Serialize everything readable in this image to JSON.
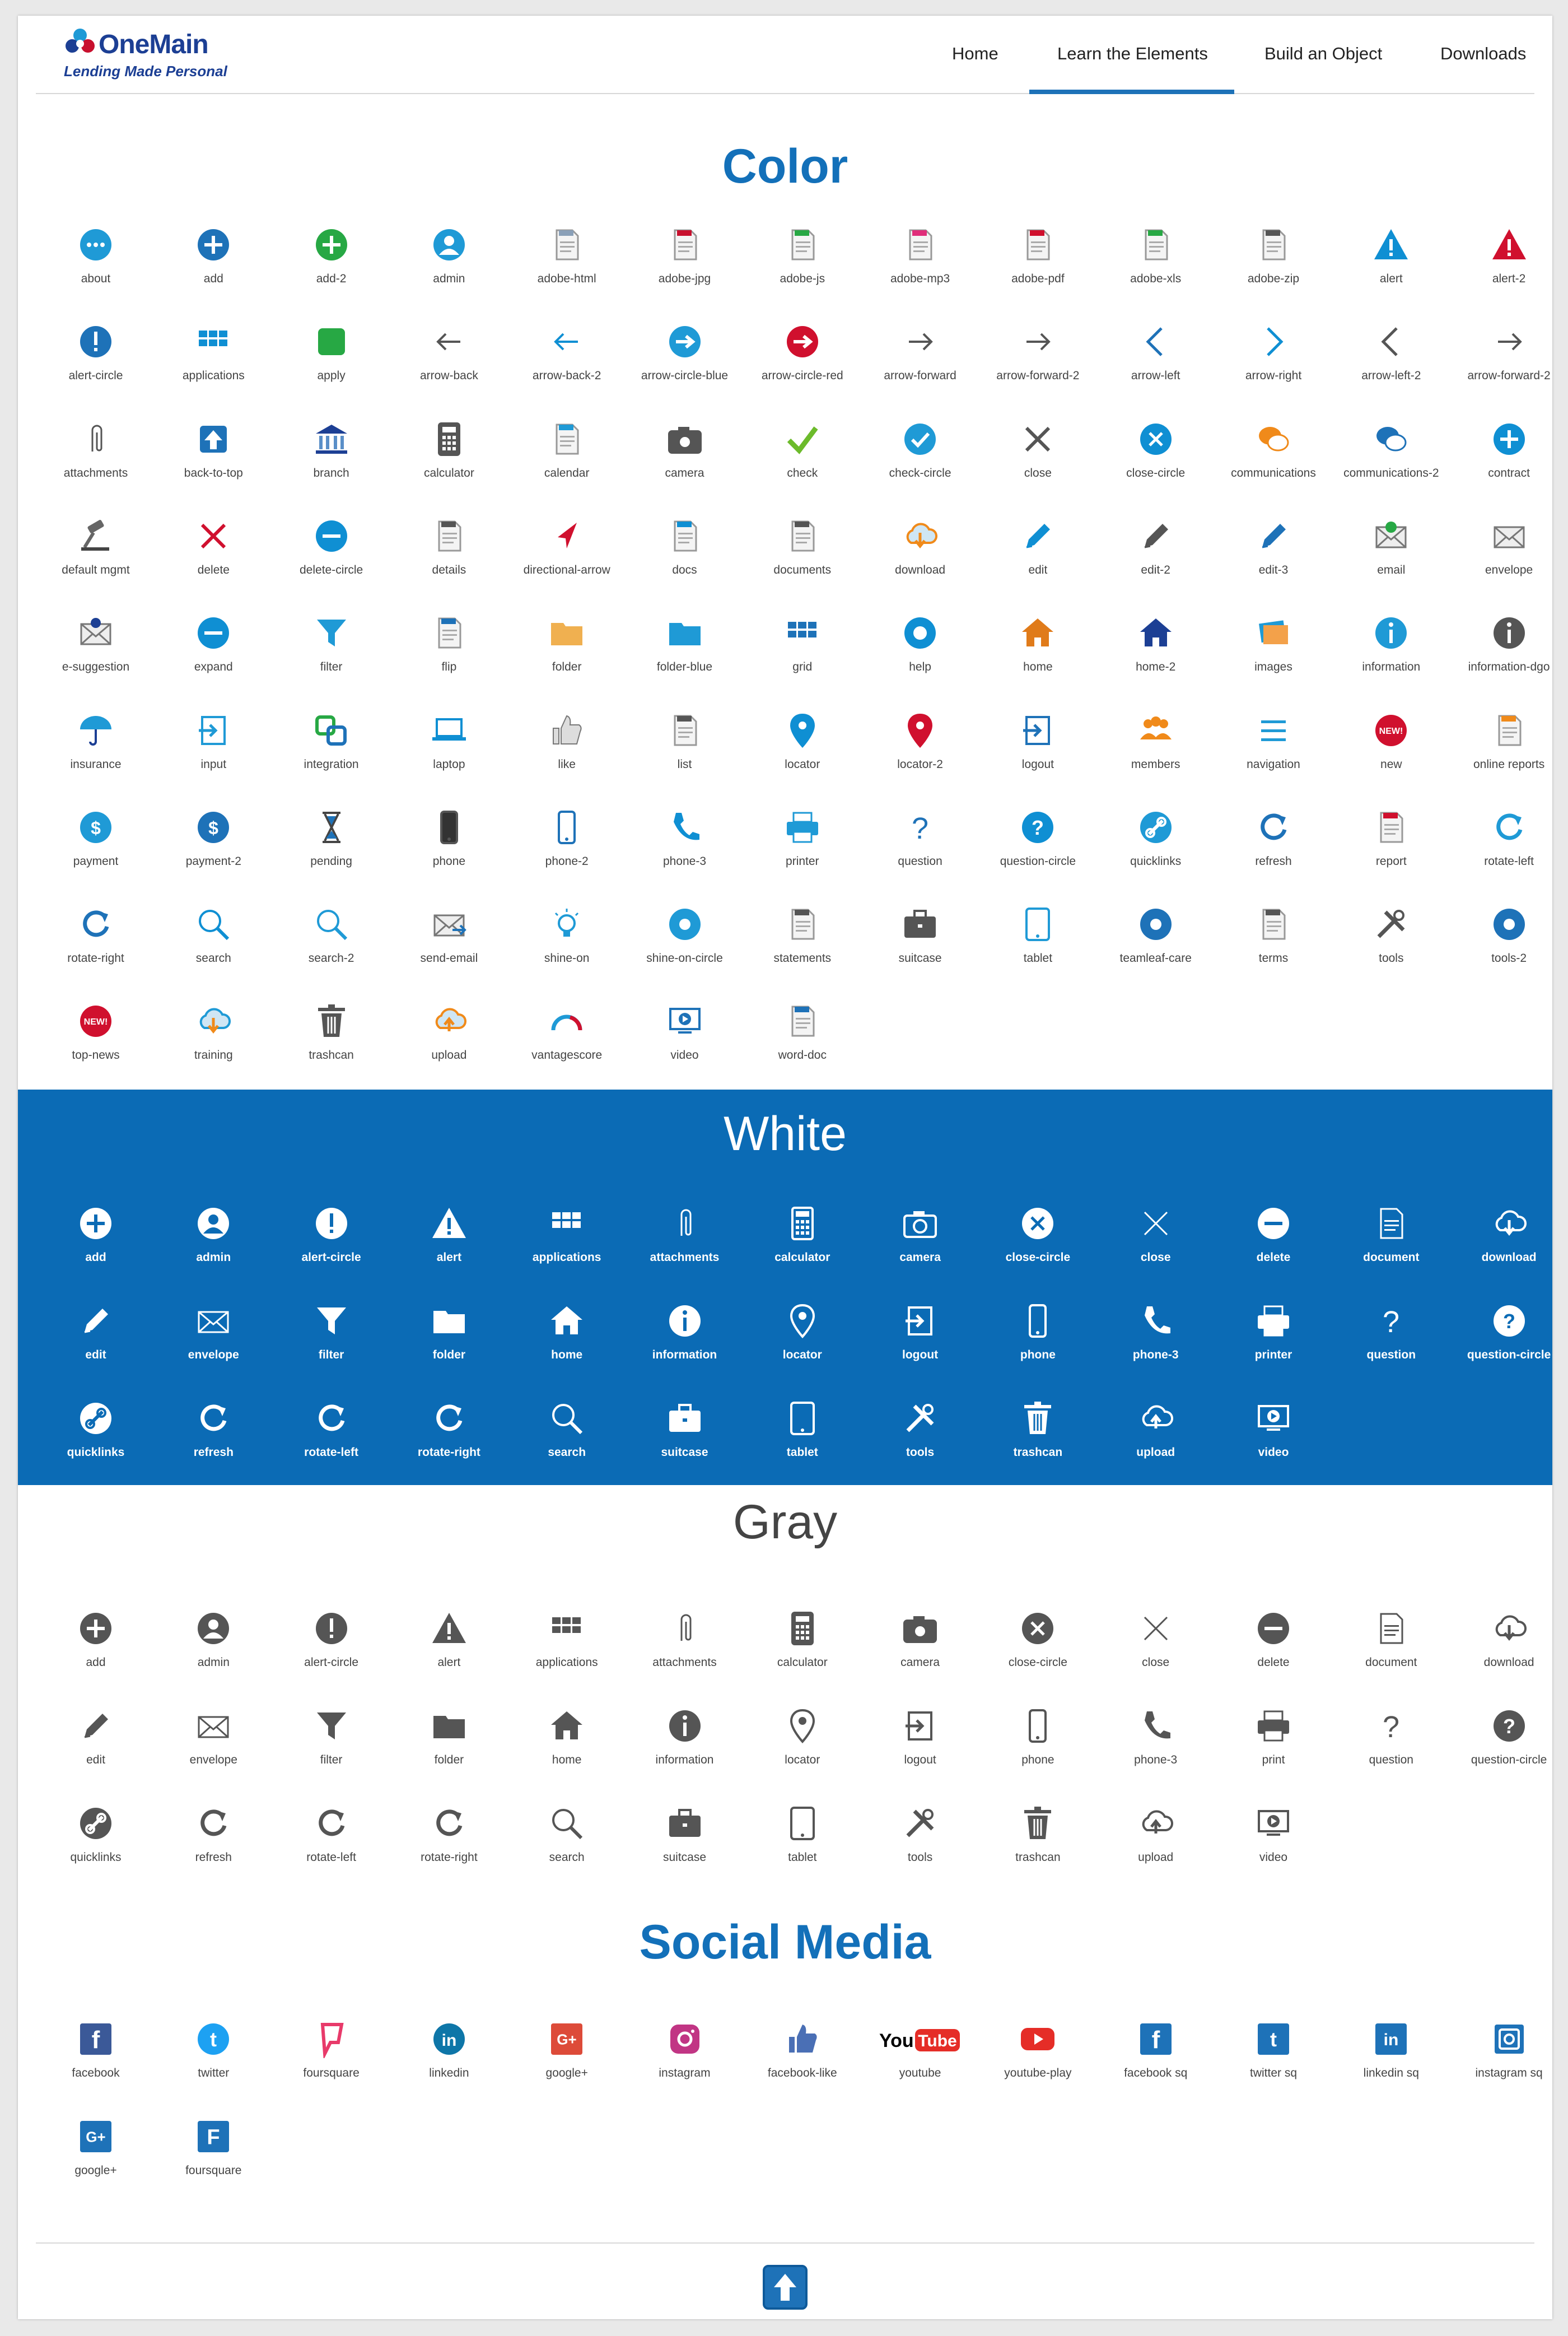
{
  "brand": {
    "name": "OneMain",
    "tagline": "Lending Made Personal"
  },
  "nav": [
    {
      "label": "Home"
    },
    {
      "label": "Learn the Elements"
    },
    {
      "label": "Build an Object"
    },
    {
      "label": "Downloads"
    }
  ],
  "sections": {
    "color": {
      "title": "Color"
    },
    "white": {
      "title": "White"
    },
    "gray": {
      "title": "Gray"
    },
    "social": {
      "title": "Social Media"
    }
  },
  "colors": {
    "brand_blue": "#0b6bb5",
    "heading_blue": "#1370b9",
    "gray_heading": "#444444",
    "gray_icon": "#555555"
  },
  "color_icons": [
    "about",
    "add",
    "add-2",
    "admin",
    "adobe-html",
    "adobe-jpg",
    "adobe-js",
    "adobe-mp3",
    "adobe-pdf",
    "adobe-xls",
    "adobe-zip",
    "alert",
    "alert-2",
    "alert-circle",
    "applications",
    "apply",
    "arrow-back",
    "arrow-back-2",
    "arrow-circle-blue",
    "arrow-circle-red",
    "arrow-forward",
    "arrow-forward-2",
    "arrow-left",
    "arrow-right",
    "arrow-left-2",
    "arrow-forward-2",
    "attachments",
    "back-to-top",
    "branch",
    "calculator",
    "calendar",
    "camera",
    "check",
    "check-circle",
    "close",
    "close-circle",
    "communications",
    "communications-2",
    "contract",
    "default mgmt",
    "delete",
    "delete-circle",
    "details",
    "directional-arrow",
    "docs",
    "documents",
    "download",
    "edit",
    "edit-2",
    "edit-3",
    "email",
    "envelope",
    "e-suggestion",
    "expand",
    "filter",
    "flip",
    "folder",
    "folder-blue",
    "grid",
    "help",
    "home",
    "home-2",
    "images",
    "information",
    "information-dgo",
    "insurance",
    "input",
    "integration",
    "laptop",
    "like",
    "list",
    "locator",
    "locator-2",
    "logout",
    "members",
    "navigation",
    "new",
    "online reports",
    "payment",
    "payment-2",
    "pending",
    "phone",
    "phone-2",
    "phone-3",
    "printer",
    "question",
    "question-circle",
    "quicklinks",
    "refresh",
    "report",
    "rotate-left",
    "rotate-right",
    "search",
    "search-2",
    "send-email",
    "shine-on",
    "shine-on-circle",
    "statements",
    "suitcase",
    "tablet",
    "teamleaf-care",
    "terms",
    "tools",
    "tools-2",
    "top-news",
    "training",
    "trashcan",
    "upload",
    "vantagescore",
    "video",
    "word-doc"
  ],
  "white_icons": [
    "add",
    "admin",
    "alert-circle",
    "alert",
    "applications",
    "attachments",
    "calculator",
    "camera",
    "close-circle",
    "close",
    "delete",
    "document",
    "download",
    "edit",
    "envelope",
    "filter",
    "folder",
    "home",
    "information",
    "locator",
    "logout",
    "phone",
    "phone-3",
    "printer",
    "question",
    "question-circle",
    "quicklinks",
    "refresh",
    "rotate-left",
    "rotate-right",
    "search",
    "suitcase",
    "tablet",
    "tools",
    "trashcan",
    "upload",
    "video"
  ],
  "gray_icons": [
    "add",
    "admin",
    "alert-circle",
    "alert",
    "applications",
    "attachments",
    "calculator",
    "camera",
    "close-circle",
    "close",
    "delete",
    "document",
    "download",
    "edit",
    "envelope",
    "filter",
    "folder",
    "home",
    "information",
    "locator",
    "logout",
    "phone",
    "phone-3",
    "print",
    "question",
    "question-circle",
    "quicklinks",
    "refresh",
    "rotate-left",
    "rotate-right",
    "search",
    "suitcase",
    "tablet",
    "tools",
    "trashcan",
    "upload",
    "video"
  ],
  "social_icons": [
    "facebook",
    "twitter",
    "foursquare",
    "linkedin",
    "google+",
    "instagram",
    "facebook-like",
    "youtube",
    "youtube-play",
    "facebook sq",
    "twitter sq",
    "linkedin sq",
    "instagram sq",
    "google+",
    "foursquare"
  ],
  "social_icon_text": {
    "facebook": "f",
    "twitter": "t",
    "foursquare": "F",
    "linkedin": "in",
    "google": "G+",
    "youtube": "You Tube"
  }
}
